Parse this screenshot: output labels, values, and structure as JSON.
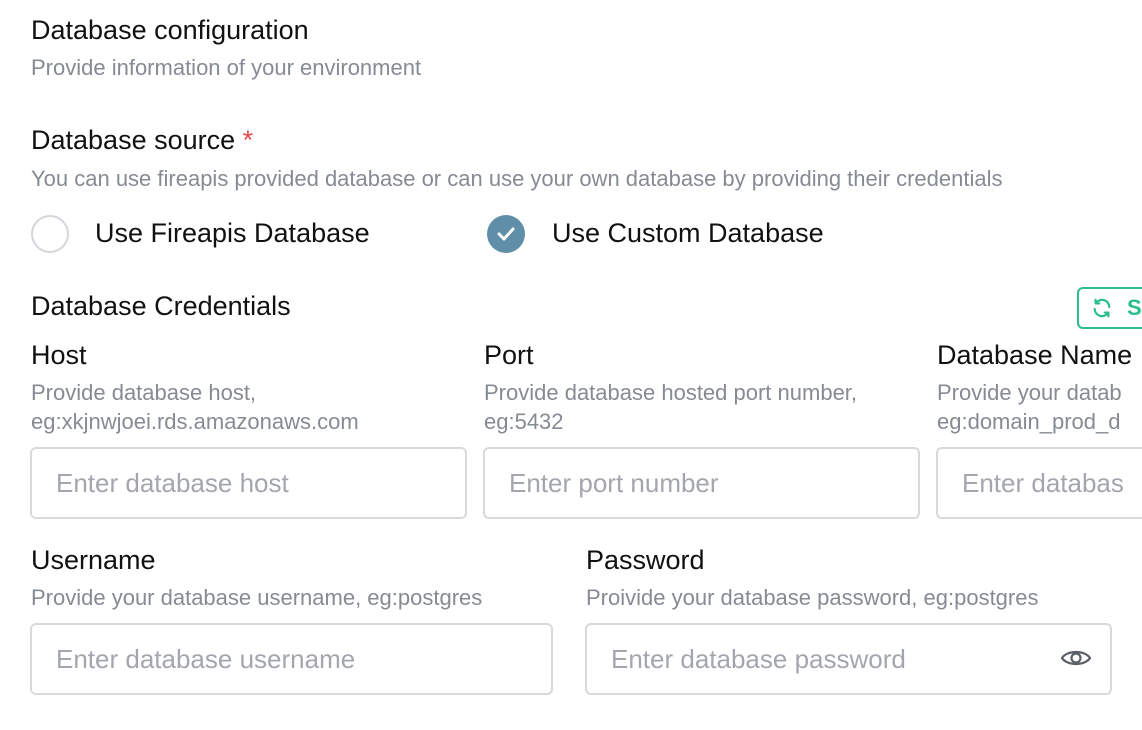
{
  "header": {
    "title": "Database configuration",
    "subtitle": "Provide information of your environment"
  },
  "source": {
    "label": "Database source",
    "required_mark": "*",
    "description": "You can use fireapis provided database or can use your own database by providing their credentials",
    "options": [
      {
        "label": "Use Fireapis Database",
        "selected": false
      },
      {
        "label": "Use Custom Database",
        "selected": true
      }
    ]
  },
  "credentials": {
    "title": "Database Credentials",
    "sync_button_label": "S",
    "host": {
      "label": "Host",
      "help_line1": "Provide database host,",
      "help_line2": "eg:xkjnwjoei.rds.amazonaws.com",
      "placeholder": "Enter database host",
      "value": ""
    },
    "port": {
      "label": "Port",
      "help_line1": "Provide database hosted port number,",
      "help_line2": "eg:5432",
      "placeholder": "Enter port number",
      "value": ""
    },
    "database_name": {
      "label": "Database Name",
      "help_line1": "Provide your datab",
      "help_line2": "eg:domain_prod_d",
      "placeholder": "Enter databas",
      "value": ""
    },
    "username": {
      "label": "Username",
      "help": "Provide your database username, eg:postgres",
      "placeholder": "Enter database username",
      "value": ""
    },
    "password": {
      "label": "Password",
      "help": "Proivide your database password, eg:postgres",
      "placeholder": "Enter database password",
      "value": ""
    }
  },
  "colors": {
    "accent_radio": "#5f8ea8",
    "sync_green": "#2bbf8a",
    "required_red": "#e5484d",
    "muted_text": "#868b93"
  }
}
